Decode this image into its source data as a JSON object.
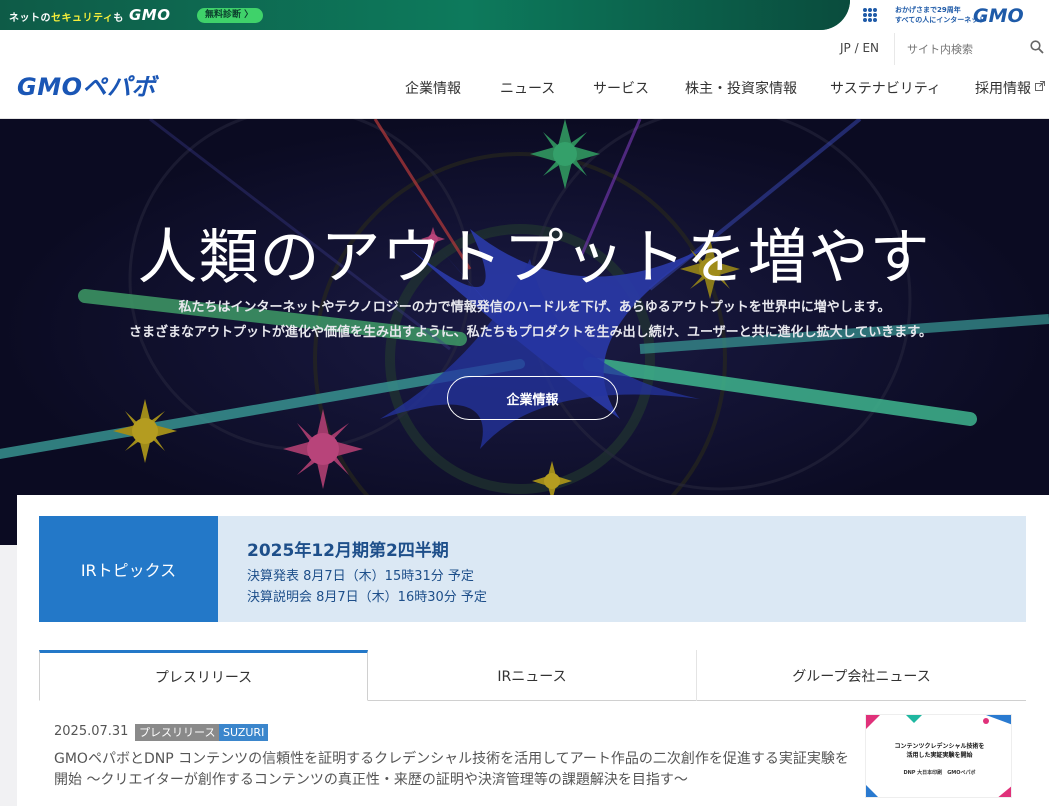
{
  "topbar": {
    "text_prefix": "ネットの",
    "text_highlight": "セキュリティ",
    "text_suffix": "も",
    "gmo": "GMO",
    "pill": "無料診断 〉",
    "slogan_1": "おかげさまで29周年",
    "slogan_2": "すべての人にインターネット",
    "gmo_right": "GMO"
  },
  "header": {
    "lang": "JP / EN",
    "search_placeholder": "サイト内検索",
    "logo": "GMOペパボ",
    "nav": [
      "企業情報",
      "ニュース",
      "サービス",
      "株主・投資家情報",
      "サステナビリティ",
      "採用情報"
    ]
  },
  "hero": {
    "title": "人類のアウトプットを増やす",
    "line1": "私たちはインターネットやテクノロジーの力で情報発信のハードルを下げ、あらゆるアウトプットを世界中に増やします。",
    "line2": "さまざまなアウトプットが進化や価値を生み出すように、私たちもプロダクトを生み出し続け、ユーザーと共に進化し拡大していきます。",
    "button": "企業情報"
  },
  "ir": {
    "label": "IRトピックス",
    "title": "2025年12月期第2四半期",
    "line1": "決算発表 8月7日（木）15時31分 予定",
    "line2": "決算説明会 8月7日（木）16時30分 予定"
  },
  "tabs": [
    "プレスリリース",
    "IRニュース",
    "グループ会社ニュース"
  ],
  "news": {
    "date": "2025.07.31",
    "badge1": "プレスリリース",
    "badge2": "SUZURI",
    "text": "GMOペパボとDNP コンテンツの信頼性を証明するクレデンシャル技術を活用してアート作品の二次創作を促進する実証実験を開始 〜クリエイターが創作するコンテンツの真正性・来歴の証明や決済管理等の課題解決を目指す〜",
    "thumb_line1": "コンテンツクレデンシャル技術を",
    "thumb_line2": "活用した実証実験を開始",
    "thumb_logo1": "DNP 大日本印刷",
    "thumb_logo2": "GMOペパボ"
  },
  "colors": {
    "accent": "#2378c8",
    "ir_bg": "#dbe8f4",
    "hero_bg": "#0f0f2e",
    "topbar_green": "#0d7a5c"
  }
}
